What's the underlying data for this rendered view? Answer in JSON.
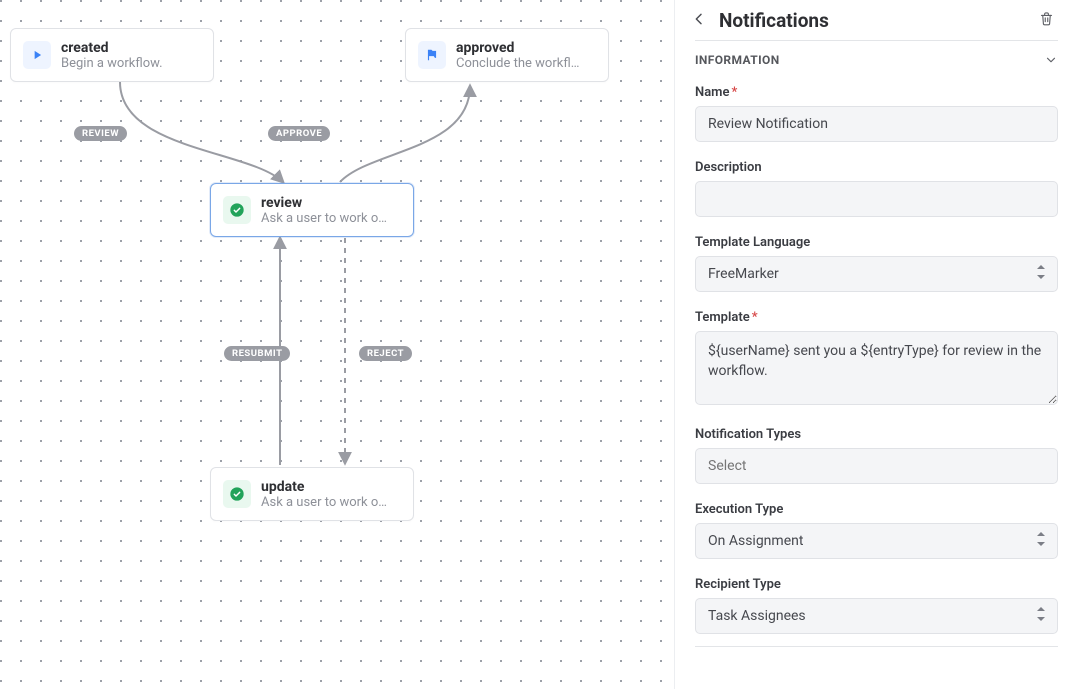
{
  "canvas": {
    "nodes": {
      "created": {
        "title": "created",
        "sub": "Begin a workflow."
      },
      "approved": {
        "title": "approved",
        "sub": "Conclude the workfl…"
      },
      "review": {
        "title": "review",
        "sub": "Ask a user to work o…"
      },
      "update": {
        "title": "update",
        "sub": "Ask a user to work o…"
      }
    },
    "edgeLabels": {
      "review": "REVIEW",
      "approve": "APPROVE",
      "resubmit": "RESUBMIT",
      "reject": "REJECT"
    }
  },
  "panel": {
    "title": "Notifications",
    "section": "INFORMATION",
    "fields": {
      "nameLabel": "Name",
      "name": "Review Notification",
      "descriptionLabel": "Description",
      "description": "",
      "templateLangLabel": "Template Language",
      "templateLang": "FreeMarker",
      "templateLabel": "Template",
      "template": "${userName} sent you a ${entryType} for review in the workflow.",
      "notifTypesLabel": "Notification Types",
      "notifTypesPlaceholder": "Select",
      "execTypeLabel": "Execution Type",
      "execType": "On Assignment",
      "recipientTypeLabel": "Recipient Type",
      "recipientType": "Task Assignees"
    }
  }
}
